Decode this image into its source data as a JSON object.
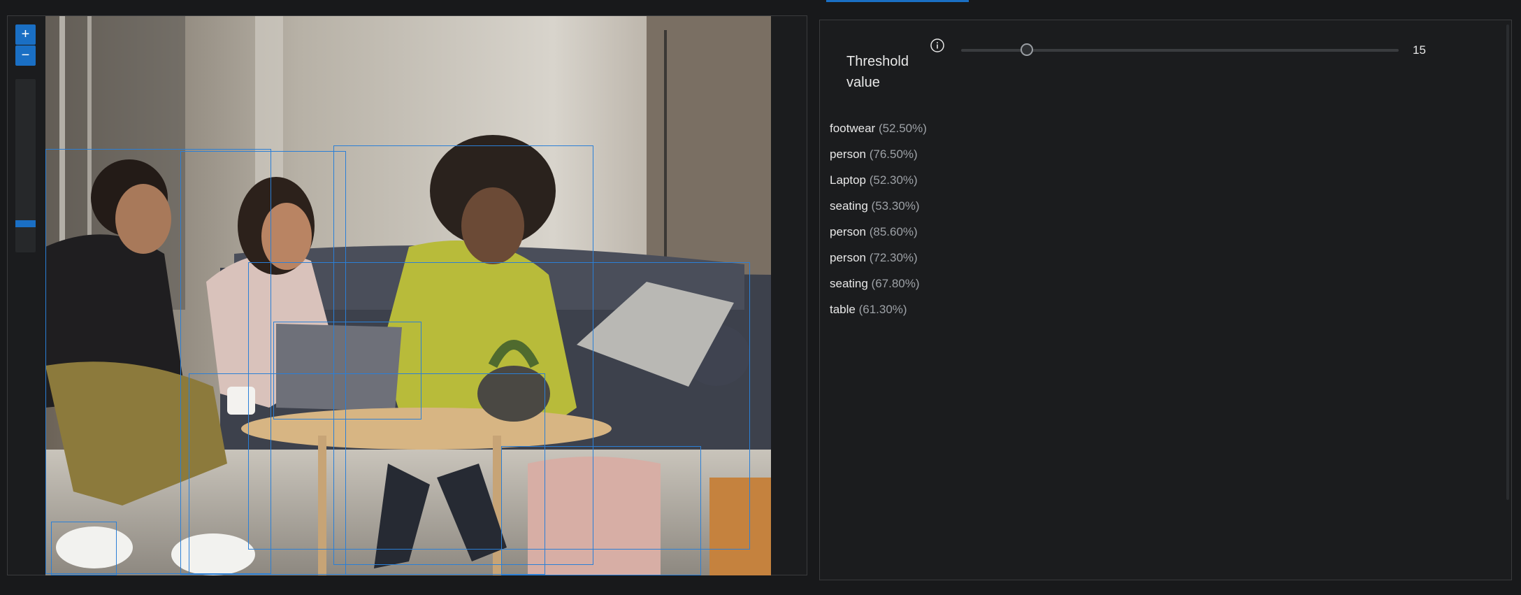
{
  "zoom": {
    "in_label": "+",
    "out_label": "−",
    "level": 0.15
  },
  "colors": {
    "accent": "#1a6fc4",
    "bbox": "#2b7fd6",
    "panel_bg": "#1b1c1e"
  },
  "threshold": {
    "label": "Threshold value",
    "info_icon": "info-icon",
    "value": 15,
    "value_text": "15",
    "max": 100
  },
  "detections": [
    {
      "name": "footwear",
      "confidence": "(52.50%)"
    },
    {
      "name": "person",
      "confidence": "(76.50%)"
    },
    {
      "name": "Laptop",
      "confidence": "(52.30%)"
    },
    {
      "name": "seating",
      "confidence": "(53.30%)"
    },
    {
      "name": "person",
      "confidence": "(85.60%)"
    },
    {
      "name": "person",
      "confidence": "(72.30%)"
    },
    {
      "name": "seating",
      "confidence": "(67.80%)"
    },
    {
      "name": "table",
      "confidence": "(61.30%)"
    }
  ]
}
